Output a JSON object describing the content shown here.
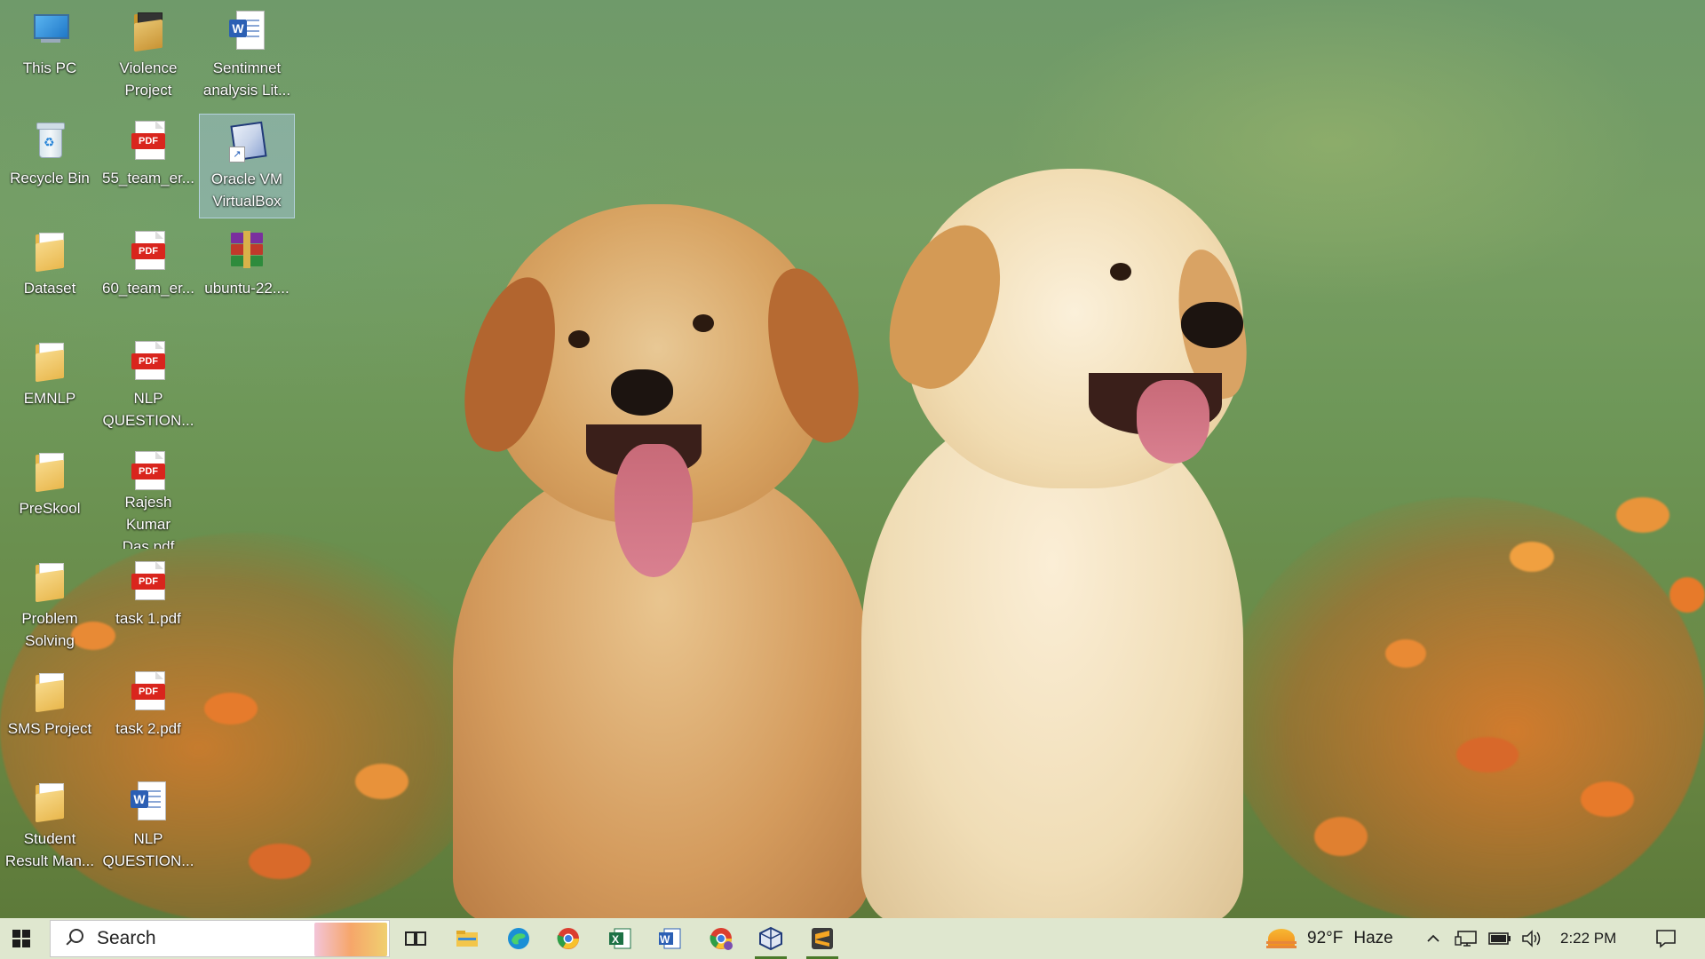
{
  "desktop": {
    "icons": [
      {
        "label": "This PC",
        "type": "pc"
      },
      {
        "label": "Violence\nProject",
        "type": "folder-dark"
      },
      {
        "label": "Sentimnet\nanalysis Lit...",
        "type": "word"
      },
      {
        "label": "Recycle Bin",
        "type": "bin"
      },
      {
        "label": "55_team_er...",
        "type": "pdf"
      },
      {
        "label": "Oracle VM\nVirtualBox",
        "type": "vbox"
      },
      {
        "label": "Dataset",
        "type": "folder"
      },
      {
        "label": "60_team_er...",
        "type": "pdf"
      },
      {
        "label": "ubuntu-22....",
        "type": "rar"
      },
      {
        "label": "EMNLP",
        "type": "folder"
      },
      {
        "label": "NLP\nQUESTION...",
        "type": "pdf"
      },
      {
        "label": "PreSkool",
        "type": "folder"
      },
      {
        "label": "Rajesh Kumar\nDas.pdf",
        "type": "pdf"
      },
      {
        "label": "Problem\nSolving",
        "type": "folder"
      },
      {
        "label": "task 1.pdf",
        "type": "pdf"
      },
      {
        "label": "SMS Project",
        "type": "folder"
      },
      {
        "label": "task 2.pdf",
        "type": "pdf"
      },
      {
        "label": "Student\nResult Man...",
        "type": "folder"
      },
      {
        "label": "NLP\nQUESTION...",
        "type": "word"
      }
    ],
    "pdf_tag": "PDF",
    "word_badge": "W"
  },
  "taskbar": {
    "search_placeholder": "Search",
    "apps": [
      "task-view",
      "file-explorer",
      "edge",
      "chrome",
      "excel",
      "word",
      "chrome-profile",
      "virtualbox",
      "winrar"
    ],
    "weather": {
      "temp": "92°F",
      "condition": "Haze"
    },
    "clock": "2:22 PM"
  },
  "colors": {
    "taskbar": "#dfe7cf",
    "accent": "#4a7a2a"
  }
}
